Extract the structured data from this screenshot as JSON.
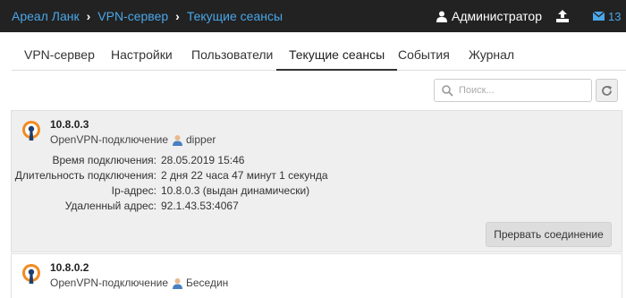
{
  "breadcrumb": {
    "root": "Ареал Ланк",
    "level1": "VPN-сервер",
    "current": "Текущие сеансы"
  },
  "header": {
    "user_label": "Администратор",
    "mail_count": "13"
  },
  "tabs": [
    {
      "label": "VPN-сервер"
    },
    {
      "label": "Настройки"
    },
    {
      "label": "Пользователи"
    },
    {
      "label": "Текущие сеансы",
      "active": true
    },
    {
      "label": "События"
    },
    {
      "label": "Журнал"
    }
  ],
  "search": {
    "placeholder": "Поиск..."
  },
  "labels": {
    "connect_time": "Время подключения:",
    "duration": "Длительность подключения:",
    "ip_address": "Ip-адрес:",
    "remote_address": "Удаленный адрес:",
    "disconnect": "Прервать соединение"
  },
  "sessions": [
    {
      "ip": "10.8.0.3",
      "type": "OpenVPN-подключение",
      "user": "dipper",
      "connect_time": "28.05.2019 15:46",
      "duration": "2 дня 22 часа 47 минут 1 секунда",
      "ip_address": "10.8.0.3 (выдан динамически)",
      "remote_address": "92.1.43.53:4067"
    },
    {
      "ip": "10.8.0.2",
      "type": "OpenVPN-подключение",
      "user": "Беседин"
    }
  ],
  "colors": {
    "topbar_bg": "#222222",
    "link": "#4aa6e8",
    "session_bg": "#efefef"
  }
}
